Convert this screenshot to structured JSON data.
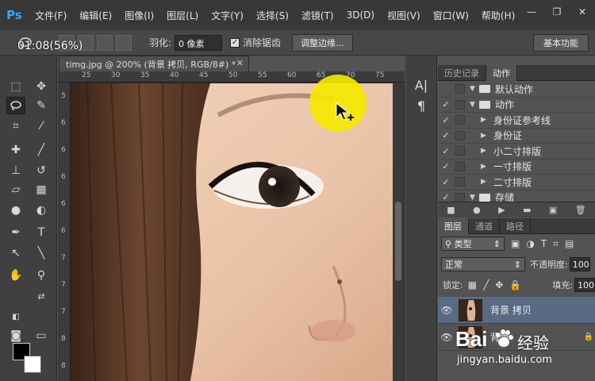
{
  "app": {
    "logo": "Ps",
    "menu": [
      "文件(F)",
      "编辑(E)",
      "图像(I)",
      "图层(L)",
      "文字(Y)",
      "选择(S)",
      "滤镜(T)",
      "3D(D)",
      "视图(V)",
      "窗口(W)",
      "帮助(H)"
    ],
    "window_controls": [
      "—",
      "❐",
      "✕"
    ]
  },
  "options": {
    "feather_label": "羽化:",
    "feather_value": "0 像素",
    "antialias_label": "消除锯齿",
    "refine_edge_label": "调整边缘...",
    "workspace_label": "基本功能"
  },
  "overlay": {
    "timer": "01:08(56%)"
  },
  "document": {
    "tab_title": "timg.jpg @ 200% (背景 拷贝, RGB/8#) *",
    "close": "✕",
    "ruler_top": [
      "25",
      "30",
      "35",
      "40",
      "45",
      "50",
      "55",
      "60",
      "65",
      "70",
      "75"
    ],
    "ruler_left": [
      "5",
      "6",
      "6",
      "6",
      "6",
      "6",
      "7",
      "7",
      "7",
      "8",
      "8"
    ]
  },
  "side_strip": {
    "icons": [
      "A|",
      "¶"
    ]
  },
  "actions_panel": {
    "tabs": [
      "历史记录",
      "动作"
    ],
    "rows": [
      {
        "check": "",
        "arrow": "▼",
        "folder": true,
        "label": "默认动作"
      },
      {
        "check": "✓",
        "arrow": "▼",
        "folder": true,
        "label": "动作"
      },
      {
        "check": "✓",
        "arrow": "▶",
        "folder": false,
        "label": "身份证参考线"
      },
      {
        "check": "✓",
        "arrow": "▶",
        "folder": false,
        "label": "身份证"
      },
      {
        "check": "✓",
        "arrow": "▶",
        "folder": false,
        "label": "小二寸排版"
      },
      {
        "check": "✓",
        "arrow": "▶",
        "folder": false,
        "label": "一寸排版"
      },
      {
        "check": "✓",
        "arrow": "▶",
        "folder": false,
        "label": "二寸排版"
      },
      {
        "check": "✓",
        "arrow": "▼",
        "folder": true,
        "label": "存储"
      }
    ],
    "footer_icons": [
      "■",
      "●",
      "▶",
      "▬",
      "▣",
      "🗑"
    ]
  },
  "layers_panel": {
    "tabs": [
      "图层",
      "通道",
      "路径"
    ],
    "filter_label": "类型",
    "blend_mode": "正常",
    "opacity_label": "不透明度:",
    "opacity_value": "100%",
    "lock_label": "锁定:",
    "fill_label": "填充:",
    "fill_value": "100%",
    "layers": [
      {
        "name": "背景 拷贝",
        "selected": true
      },
      {
        "name": "背景",
        "selected": false
      }
    ]
  },
  "watermark": {
    "brand_text": "Bai",
    "brand_suffix": "经验",
    "url": "jingyan.baidu.com"
  }
}
